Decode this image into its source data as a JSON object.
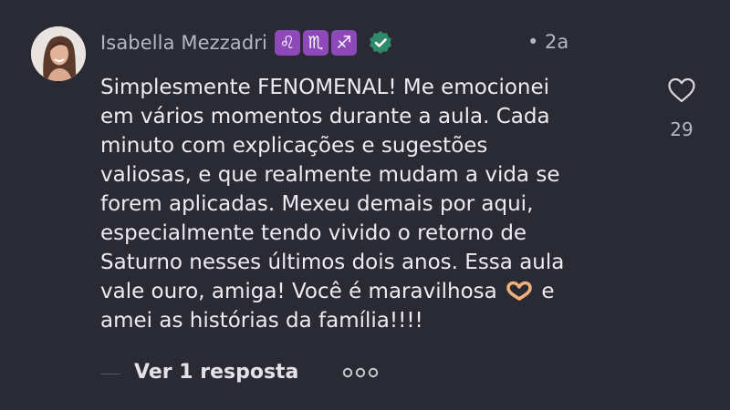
{
  "comment": {
    "author": "Isabella Mezzadri",
    "zodiac_badges": [
      "♌",
      "♏",
      "♐"
    ],
    "verified_icon": "verified-check-icon",
    "timestamp": "• 2a",
    "lines": [
      "Simplesmente FENOMENAL! Me emocionei",
      "em vários momentos durante a aula. Cada",
      "minuto com explicações e sugestões",
      "valiosas, e que realmente mudam a vida se",
      "forem aplicadas. Mexeu demais por aqui,",
      "especialmente tendo vivido o retorno de",
      "Saturno nesses últimos dois anos. Essa aula",
      "amei as histórias da família!!!!"
    ],
    "line8_before_emoji": "vale ouro, amiga! Você é maravilhosa",
    "line8_after_emoji": "e",
    "like_count": "29"
  },
  "replies": {
    "view_label": "Ver 1 resposta"
  },
  "colors": {
    "background": "#2a2a34",
    "text": "#ececf0",
    "muted": "#b7b7c2",
    "zodiac_badge": "#8d49b8",
    "verified": "#2f8a6b"
  },
  "icons": {
    "like": "heart-outline-icon",
    "more": "more-dots-icon",
    "emoji": "heart-hands-emoji"
  }
}
